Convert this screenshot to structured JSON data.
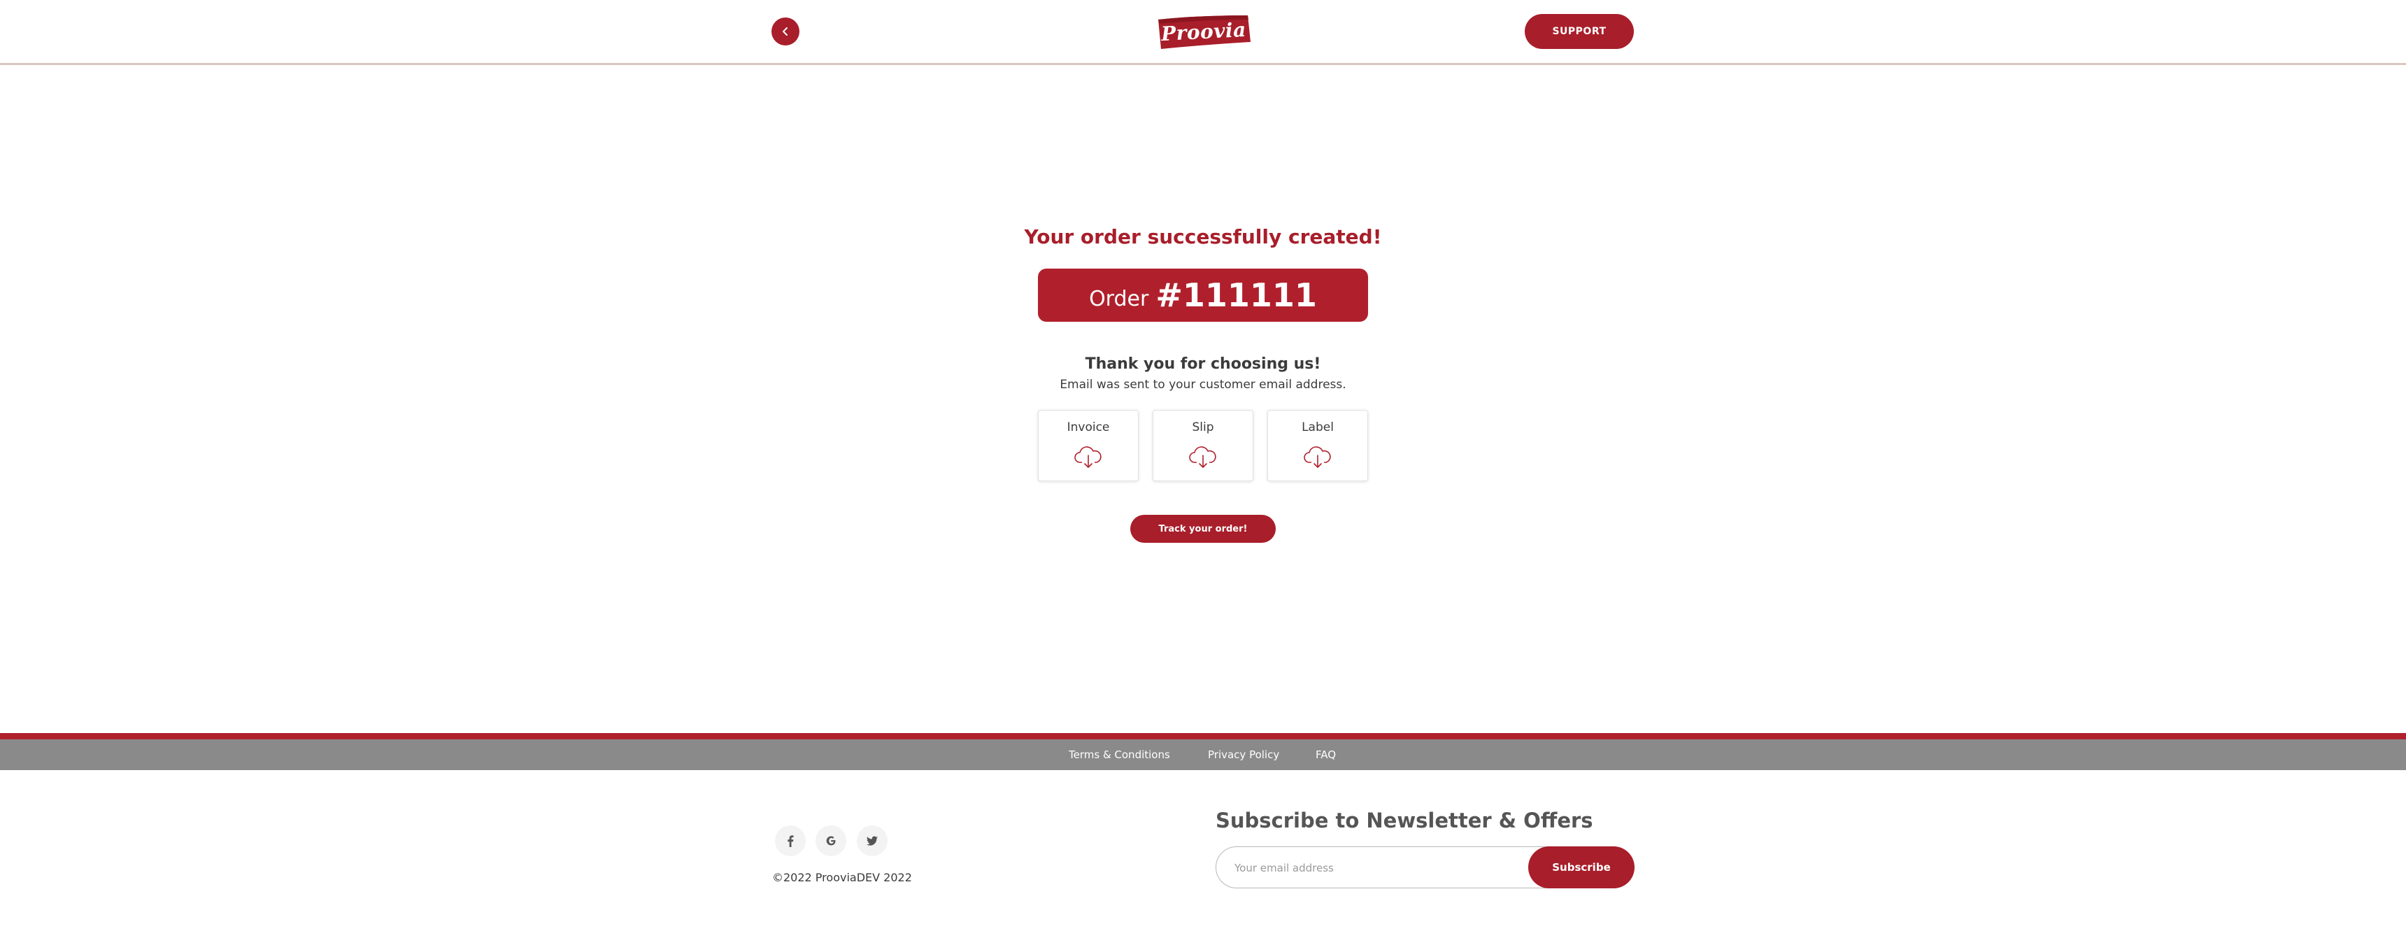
{
  "header": {
    "logo_text": "Proovia",
    "support_label": "SUPPORT",
    "back_icon": "chevron-left-icon"
  },
  "main": {
    "success_title": "Your order successfully created!",
    "order_label": "Order",
    "order_number": "#111111",
    "thanks": "Thank you for choosing us!",
    "email_sent": "Email was sent to your customer email address.",
    "downloads": [
      {
        "label": "Invoice",
        "icon": "cloud-download-icon"
      },
      {
        "label": "Slip",
        "icon": "cloud-download-icon"
      },
      {
        "label": "Label",
        "icon": "cloud-download-icon"
      }
    ],
    "track_label": "Track your order!"
  },
  "footer": {
    "links": [
      "Terms & Conditions",
      "Privacy Policy",
      "FAQ"
    ],
    "social": [
      "facebook-icon",
      "google-icon",
      "twitter-icon"
    ],
    "copyright": "©2022 ProoviaDEV 2022",
    "newsletter_title": "Subscribe to Newsletter & Offers",
    "email_placeholder": "Your email address",
    "subscribe_label": "Subscribe"
  },
  "colors": {
    "brand": "#a81e2a",
    "footer_bar": "#8a8a8a"
  }
}
